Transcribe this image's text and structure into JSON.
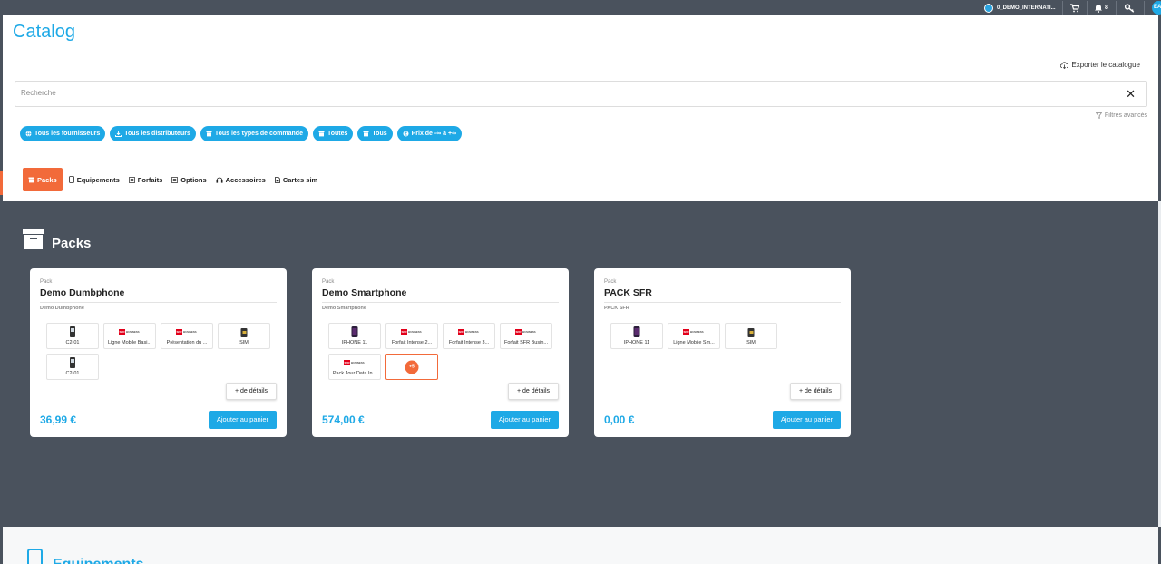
{
  "topbar": {
    "user_label": "0_DEMO_INTERNATI...",
    "notifications_count": "8",
    "avatar_initials": "EA"
  },
  "header": {
    "title": "Catalog",
    "export_label": "Exporter le catalogue",
    "search_placeholder": "Recherche",
    "advanced_filters_label": "Filtres avancés"
  },
  "filters": [
    {
      "label": "Tous les fournisseurs",
      "icon": "globe-icon"
    },
    {
      "label": "Tous les distributeurs",
      "icon": "download-icon"
    },
    {
      "label": "Tous les types de commande",
      "icon": "box-icon"
    },
    {
      "label": "Toutes",
      "icon": "box-icon"
    },
    {
      "label": "Tous",
      "icon": "box-icon"
    },
    {
      "label": "Prix de -∞ à +∞",
      "icon": "euro-icon"
    }
  ],
  "tabs": [
    {
      "label": "Packs",
      "icon": "archive-icon",
      "active": true
    },
    {
      "label": "Equipements",
      "icon": "phone-icon",
      "active": false
    },
    {
      "label": "Forfaits",
      "icon": "list-icon",
      "active": false
    },
    {
      "label": "Options",
      "icon": "list-icon",
      "active": false
    },
    {
      "label": "Accessoires",
      "icon": "headphones-icon",
      "active": false
    },
    {
      "label": "Cartes sim",
      "icon": "sim-icon",
      "active": false
    }
  ],
  "packs_section": {
    "title": "Packs",
    "cards": [
      {
        "kind": "Pack",
        "name": "Demo Dumbphone",
        "subtitle": "Demo Dumbphone",
        "items": [
          "C2-01",
          "Ligne Mobile Basi...",
          "Présentation du ...",
          "SIM",
          "C2-01"
        ],
        "details_label": "+ de détails",
        "price": "36,99 €",
        "cart_label": "Ajouter au panier"
      },
      {
        "kind": "Pack",
        "name": "Demo Smartphone",
        "subtitle": "Demo Smartphone",
        "items": [
          "IPHONE 11",
          "Forfait Intense 2...",
          "Forfait Intense 3...",
          "Forfait SFR Busin...",
          "Pack Jour Data In..."
        ],
        "more_label": "+5",
        "details_label": "+ de détails",
        "price": "574,00 €",
        "cart_label": "Ajouter au panier"
      },
      {
        "kind": "Pack",
        "name": "PACK SFR",
        "subtitle": "PACK SFR",
        "items": [
          "IPHONE 11",
          "Ligne Mobile Sm...",
          "SIM"
        ],
        "details_label": "+ de détails",
        "price": "0,00 €",
        "cart_label": "Ajouter au panier"
      }
    ]
  },
  "next_section": {
    "title": "Equipements"
  },
  "colors": {
    "accent": "#1ea9e6",
    "active_tab": "#f26a3a",
    "dark_bg": "#4a525d"
  }
}
